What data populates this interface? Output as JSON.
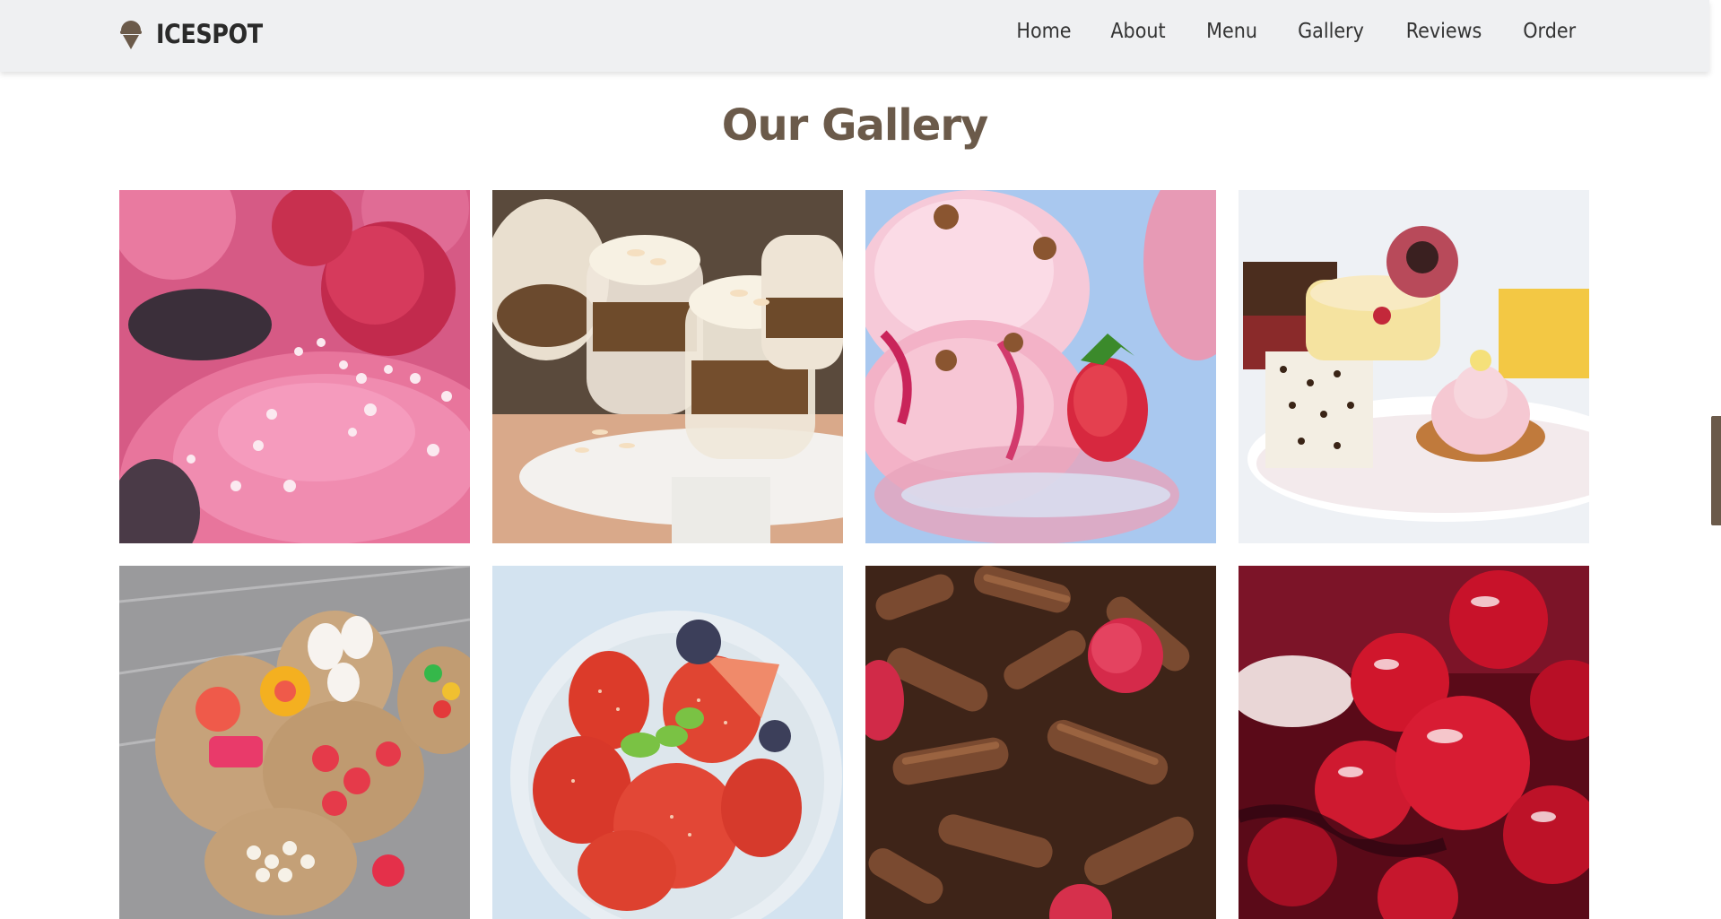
{
  "brand": {
    "name": "ICESPOT",
    "icon": "ice-cream-cone-icon"
  },
  "nav": {
    "items": [
      {
        "label": "Home"
      },
      {
        "label": "About"
      },
      {
        "label": "Menu"
      },
      {
        "label": "Gallery"
      },
      {
        "label": "Reviews"
      },
      {
        "label": "Order"
      }
    ]
  },
  "gallery": {
    "title": "Our Gallery",
    "images": [
      {
        "subject": "pink cupcakes with raspberry"
      },
      {
        "subject": "layered dessert cups with almonds"
      },
      {
        "subject": "strawberry ice cream sundae"
      },
      {
        "subject": "assorted pastries plate"
      },
      {
        "subject": "candy bags"
      },
      {
        "subject": "bowl of strawberries with mint"
      },
      {
        "subject": "chocolate curls with raspberries"
      },
      {
        "subject": "glazed cherries"
      }
    ]
  },
  "colors": {
    "accent": "#6b5a4a",
    "nav_bg": "#eff0f2",
    "text": "#333333"
  }
}
